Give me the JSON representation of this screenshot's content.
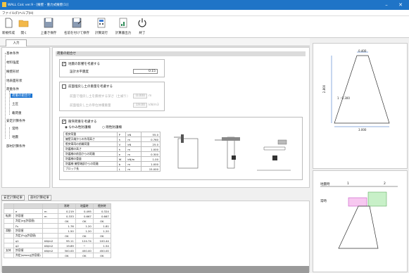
{
  "window": {
    "title": "WALL Calc ver.9 - [擁壁 - 重力式擁壁(1)]",
    "min": "–",
    "close": "✕"
  },
  "menu": [
    "ファイル(F)",
    "ヘルプ(H)"
  ],
  "toolbar": [
    "新規作成",
    "開く",
    "上書き保存",
    "名前を付けて保存",
    "計算実行",
    "計算書出力",
    "終了"
  ],
  "tab": "入力",
  "tree": [
    "基本条件",
    "材料強度",
    "擁壁形状",
    "地表面形状",
    "荷重条件",
    "荷重の組合せ",
    "土圧",
    "載荷重",
    "安定計算条件",
    "常時",
    "地震",
    "部材計算条件"
  ],
  "section": "荷重の組合せ",
  "quake": {
    "check": "地震の影響を考慮する",
    "label": "設計水平震度",
    "value": "0.15"
  },
  "front": {
    "check": "前面埋戻し土の重量を考慮する",
    "r1": "前面で埋戻し土を無視する深さ（土被り）",
    "v1": "0.000",
    "u1": "m",
    "r2": "前面埋戻し土の単位体積重量",
    "v2": "19.00",
    "u2": "kN/m3"
  },
  "collision": {
    "check": "衝突荷重を考慮する",
    "opt1": "なわみ性防護柵",
    "opt2": "剛性防護柵",
    "rows": [
      [
        "衝突荷重",
        "P",
        "kN",
        "55.0"
      ],
      [
        "擁壁天端からの作用高さ",
        "h",
        "m",
        "0.760"
      ],
      [
        "衝突車両の前輪荷重",
        "V",
        "kN",
        "25.0"
      ],
      [
        "防護柵の高さ",
        "h",
        "m",
        "1.000"
      ],
      [
        "防護柵の前面からの距離",
        "e",
        "m",
        "0.300"
      ],
      [
        "防護柵の重量",
        "W",
        "kN/m",
        "1.00"
      ],
      [
        "防護柵 擁壁端部からの距離",
        "b",
        "m",
        "1.000"
      ],
      [
        "ブロック長",
        "L",
        "m",
        "15.000"
      ]
    ]
  },
  "results": {
    "title": "安定計算結果",
    "tab2": "部材計算結果",
    "cols": [
      "常時",
      "地震時",
      "衝突時"
    ],
    "rows": [
      [
        "",
        "e",
        "m",
        "0.219",
        "0.495",
        "0.324"
      ],
      [
        "転倒",
        "許容値",
        "m",
        "0.333",
        "0.667",
        "0.667"
      ],
      [
        "",
        "判定(e≦許容値)",
        "",
        "OK",
        "OK",
        "OK"
      ],
      [
        "",
        "Fs",
        "",
        "1.76",
        "1.20",
        "1.81"
      ],
      [
        "滑動",
        "許容値",
        "",
        "1.50",
        "1.20",
        "1.20"
      ],
      [
        "",
        "判定(Fs≧許容値)",
        "",
        "OK",
        "OK",
        "OK"
      ],
      [
        "",
        "q1",
        "kN/m2",
        "95.11",
        "124.74",
        "100.44"
      ],
      [
        "",
        "q2",
        "kN/m2",
        "19.89",
        "−",
        "1.54"
      ],
      [
        "支持",
        "許容値",
        "kN/m2",
        "300.00",
        "450.00",
        "450.00"
      ],
      [
        "",
        "判定(qmax≦許容値)",
        "",
        "OK",
        "OK",
        "OK"
      ]
    ]
  },
  "diagram": {
    "top": "0.400",
    "h": "2.800",
    "h2": "1 : 0.300",
    "base": "3.000"
  },
  "loads": {
    "seis": "地震時",
    "one": "1",
    "two": "2",
    "normal": "常時"
  }
}
